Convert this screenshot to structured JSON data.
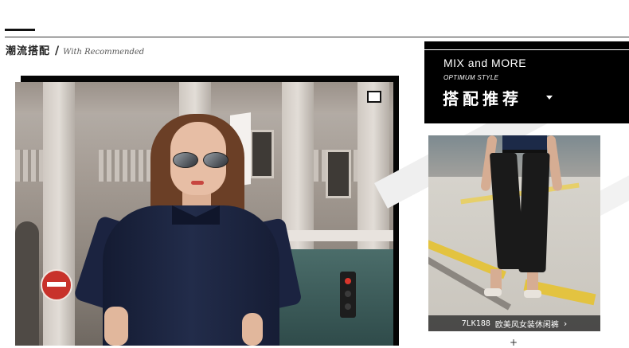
{
  "section": {
    "title_cn": "潮流搭配",
    "separator": "/",
    "title_en": "With Recommended"
  },
  "promo": {
    "mix": "MIX and MORE",
    "optimum": "OPTIMUM STYLE",
    "recommend": "搭配推荐"
  },
  "product": {
    "code": "7LK188",
    "name": "欧美风女装休闲裤",
    "chevron": "›"
  },
  "misc": {
    "plus": "+"
  },
  "icons": {
    "expand": "expand-icon",
    "caret": "caret-down-icon",
    "chevron": "chevron-right-icon"
  },
  "colors": {
    "accent": "#000000",
    "caption_bg": "#282828"
  }
}
